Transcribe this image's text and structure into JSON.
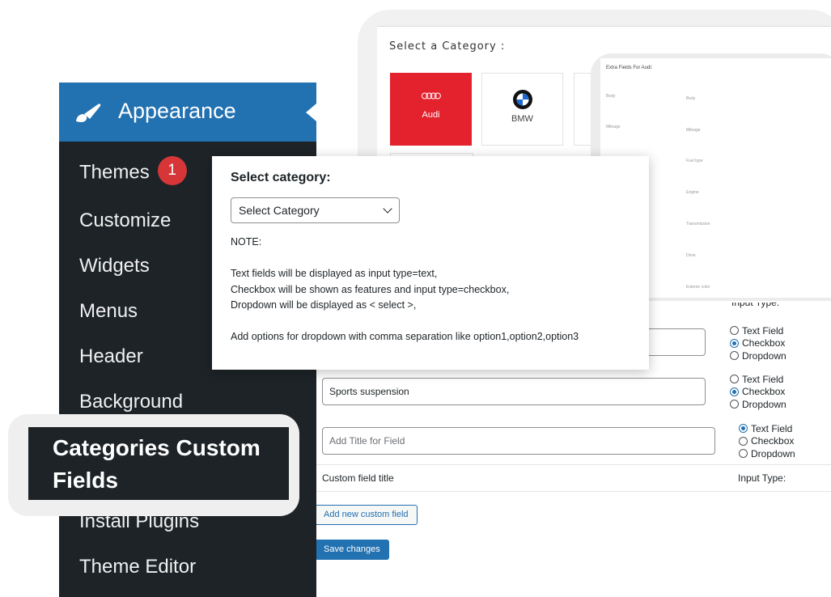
{
  "category_picker": {
    "title": "Select a Category :",
    "categories": [
      {
        "name": "Audi",
        "logo": "audi-rings"
      },
      {
        "name": "BMW",
        "logo": "bmw-roundel"
      }
    ],
    "colors": {
      "selected": "#e3222e"
    }
  },
  "extra_fields": {
    "title": "Extra Fields For Audi:",
    "left_labels": [
      "Body",
      "Mileage"
    ],
    "right_labels": [
      "Body",
      "Mileage",
      "Fuel type",
      "Engine",
      "Transmission",
      "Drive",
      "Exterior color"
    ]
  },
  "sidebar": {
    "section_title": "Appearance",
    "section_icon": "paintbrush-icon",
    "items": [
      {
        "label": "Themes",
        "badge": "1"
      },
      {
        "label": "Customize"
      },
      {
        "label": "Widgets"
      },
      {
        "label": "Menus"
      },
      {
        "label": "Header"
      },
      {
        "label": "Background"
      },
      {
        "label": "Install Plugins"
      },
      {
        "label": "Theme Editor"
      }
    ],
    "active_item": {
      "line1": "Categories Custom",
      "line2": "Fields"
    },
    "colors": {
      "bg": "#1d2327",
      "header": "#2271b1",
      "badge": "#d63638"
    }
  },
  "popup": {
    "title": "Select category:",
    "select_value": "Select Category",
    "note_heading": "NOTE:",
    "note_lines": [
      "Text fields will be displayed as input type=text,",
      "Checkbox will be shown as features and input type=checkbox,",
      "Dropdown will be displayed as < select >,"
    ],
    "note_dropdown": "Add options for dropdown with comma separation like option1,option2,option3"
  },
  "form": {
    "input_type_header": "Input Type:",
    "radio_options": [
      "Text Field",
      "Checkbox",
      "Dropdown"
    ],
    "rows": [
      {
        "value": "",
        "placeholder": "",
        "selected": "Checkbox"
      },
      {
        "value": "Sports suspension",
        "placeholder": "",
        "selected": "Checkbox"
      },
      {
        "value": "",
        "placeholder": "Add Title for Field",
        "selected": "Text Field"
      }
    ],
    "footer_title": "Custom field title",
    "footer_type": "Input Type:",
    "add_button": "Add new custom field",
    "save_button": "Save changes",
    "colors": {
      "primary": "#2271b1"
    }
  }
}
